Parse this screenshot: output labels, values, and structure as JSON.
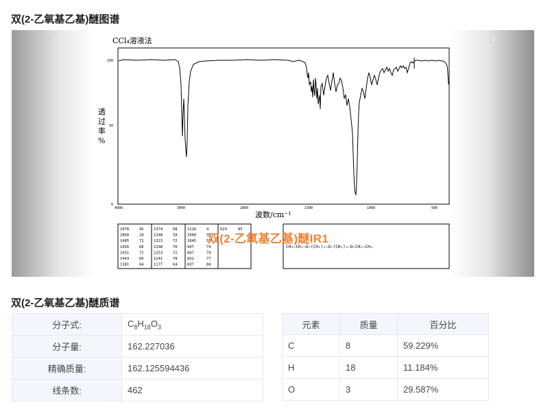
{
  "page": {
    "ir_title": "双(2-乙氧基乙基)醚图谱",
    "ms_title": "双(2-乙氧基乙基)醚质谱"
  },
  "carousel": {
    "prev_icon": "chevron-left-icon",
    "next_icon": "chevron-right-icon",
    "prev_glyph": "‹",
    "next_glyph": "›"
  },
  "spectrum": {
    "method": "CCl₄溶液法",
    "y_label_chars": [
      "透",
      "过",
      "率",
      "%"
    ],
    "y_ticks": [
      "100",
      "50",
      "0"
    ],
    "x_ticks": [
      "4000",
      "3000",
      "2000",
      "1500",
      "1000",
      "500"
    ],
    "x_label": "波数/cm⁻¹",
    "watermark": "双(2-乙氧基乙基)醚IR1",
    "structure": "CH₃—CH₂—O—(CH₂)₂—O—(CH₂)₂—O—CH₂—CH₃",
    "peak_table": [
      [
        "2978",
        "45",
        "1374",
        "68",
        "1116",
        "4",
        "629",
        "85"
      ],
      [
        "2868",
        "28",
        "1348",
        "58",
        "1060",
        "55",
        "",
        ""
      ],
      [
        "1485",
        "72",
        "1323",
        "72",
        "1045",
        "55",
        "",
        ""
      ],
      [
        "1456",
        "66",
        "1298",
        "70",
        "947",
        "74",
        "",
        ""
      ],
      [
        "1451",
        "72",
        "1253",
        "72",
        "847",
        "74",
        "",
        ""
      ],
      [
        "1443",
        "66",
        "1241",
        "78",
        "832",
        "77",
        "",
        ""
      ],
      [
        "1381",
        "64",
        "1177",
        "64",
        "837",
        "84",
        "",
        ""
      ]
    ]
  },
  "molecule": {
    "rows": [
      {
        "label": "分子式:",
        "value": "C8H18O3"
      },
      {
        "label": "分子量:",
        "value": "162.227036"
      },
      {
        "label": "精确质量:",
        "value": "162.125594436"
      },
      {
        "label": "线条数:",
        "value": "462"
      }
    ],
    "formula_parts": {
      "c": "C",
      "c_n": "8",
      "h": "H",
      "h_n": "18",
      "o": "O",
      "o_n": "3"
    }
  },
  "elements": {
    "headers": [
      "元素",
      "质量",
      "百分比"
    ],
    "rows": [
      [
        "C",
        "8",
        "59.229%"
      ],
      [
        "H",
        "18",
        "11.184%"
      ],
      [
        "O",
        "3",
        "29.587%"
      ]
    ]
  }
}
